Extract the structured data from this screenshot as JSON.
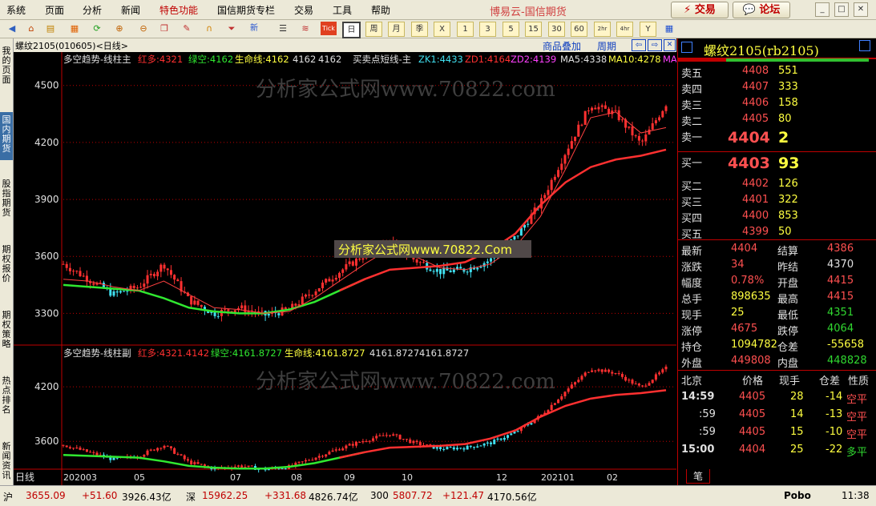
{
  "menu": {
    "items": [
      "系统",
      "页面",
      "分析",
      "新闻",
      "特色功能",
      "国信期货专栏",
      "交易",
      "工具",
      "帮助"
    ],
    "title": "博易云-国信期货",
    "trade_btn": "交易",
    "forum_btn": "论坛"
  },
  "toolbar": {
    "periods": [
      "日",
      "周",
      "月",
      "季",
      "X",
      "1",
      "3",
      "5",
      "15",
      "30",
      "60",
      "2hr",
      "4hr",
      "Y"
    ]
  },
  "sidebar": {
    "items": [
      "我的页面",
      "国内期货",
      "股指期货",
      "期权报价",
      "期权策略",
      "热点排名",
      "新闻资讯"
    ]
  },
  "chart_info": {
    "symbol_code": "螺纹2105(010605)<日线>",
    "overlay_btn": "商品叠加",
    "period_btn": "周期"
  },
  "main_legend": {
    "title": "多空趋势-线柱主",
    "hong": "红多:4321",
    "lv": "绿空:4162",
    "sml": "生命线:4162",
    "v1": "4162",
    "v2": "4162",
    "mm": "买卖点短线-主",
    "zk": "ZK1:4433",
    "zd1": "ZD1:4164",
    "zd2": "ZD2:4139",
    "ma5": "MA5:4338",
    "ma10": "MA10:4278",
    "ma": "MA"
  },
  "sub_legend": {
    "title": "多空趋势-线柱副",
    "hong": "红多:4321.4142",
    "lv": "绿空:4161.8727",
    "sml": "生命线:4161.8727",
    "v1": "4161.8727",
    "v2": "4161.8727"
  },
  "watermark": {
    "text1": "分析家公式网www.70822.com",
    "text2": "分析家公式网www.70822.com",
    "text3": "分析家公式网www.70822.Com"
  },
  "x_axis": {
    "label": "日线",
    "ticks": [
      "202003",
      "05",
      "07",
      "08",
      "09",
      "10",
      "12",
      "202101",
      "02"
    ]
  },
  "colors": {
    "red": "#ff3030",
    "green": "#30e830",
    "cyan": "#40e0f0",
    "chrome": "#ece9d8"
  },
  "chart_data": [
    {
      "type": "line",
      "title": "螺纹2105 日线 (主图)",
      "yticks": [
        3300,
        3600,
        3900,
        4200,
        4500
      ],
      "ylim": [
        3150,
        4600
      ],
      "x": [
        0,
        10,
        20,
        30,
        40,
        50,
        60,
        70,
        80,
        90,
        100,
        110,
        120,
        130,
        140,
        150,
        160,
        170,
        180,
        190,
        200,
        210,
        220,
        230,
        240
      ],
      "close": [
        3560,
        3480,
        3400,
        3440,
        3560,
        3370,
        3300,
        3330,
        3290,
        3320,
        3420,
        3520,
        3610,
        3680,
        3580,
        3520,
        3530,
        3580,
        3700,
        3880,
        4150,
        4400,
        4350,
        4190,
        4404
      ],
      "lifeline": [
        3450,
        3440,
        3430,
        3420,
        3380,
        3330,
        3310,
        3300,
        3300,
        3320,
        3360,
        3420,
        3480,
        3530,
        3540,
        3550,
        3570,
        3630,
        3720,
        3870,
        3990,
        4070,
        4110,
        4130,
        4162
      ],
      "ma10": [
        3480,
        3470,
        3440,
        3420,
        3470,
        3400,
        3330,
        3320,
        3300,
        3310,
        3380,
        3470,
        3560,
        3640,
        3600,
        3540,
        3530,
        3560,
        3650,
        3810,
        4060,
        4330,
        4360,
        4250,
        4278
      ]
    },
    {
      "type": "line",
      "title": "多空趋势-线柱副",
      "yticks": [
        3600,
        4200
      ],
      "ylim": [
        3320,
        4500
      ],
      "x": [
        0,
        10,
        20,
        30,
        40,
        50,
        60,
        70,
        80,
        90,
        100,
        110,
        120,
        130,
        140,
        150,
        160,
        170,
        180,
        190,
        200,
        210,
        220,
        230,
        240
      ],
      "close": [
        3560,
        3480,
        3400,
        3440,
        3560,
        3370,
        3300,
        3330,
        3290,
        3320,
        3420,
        3520,
        3610,
        3680,
        3580,
        3520,
        3530,
        3580,
        3700,
        3880,
        4150,
        4400,
        4350,
        4190,
        4404
      ],
      "lifeline": [
        3450,
        3440,
        3430,
        3420,
        3380,
        3330,
        3310,
        3300,
        3300,
        3320,
        3360,
        3420,
        3480,
        3530,
        3540,
        3550,
        3570,
        3630,
        3720,
        3870,
        3990,
        4070,
        4110,
        4130,
        4162
      ]
    }
  ],
  "quote": {
    "title": "螺纹2105(rb2105)",
    "asks": [
      {
        "label": "卖五",
        "price": "4408",
        "vol": "551"
      },
      {
        "label": "卖四",
        "price": "4407",
        "vol": "333"
      },
      {
        "label": "卖三",
        "price": "4406",
        "vol": "158"
      },
      {
        "label": "卖二",
        "price": "4405",
        "vol": "80"
      }
    ],
    "ask1": {
      "label": "卖一",
      "price": "4404",
      "vol": "2"
    },
    "bid1": {
      "label": "买一",
      "price": "4403",
      "vol": "93"
    },
    "bids": [
      {
        "label": "买二",
        "price": "4402",
        "vol": "126"
      },
      {
        "label": "买三",
        "price": "4401",
        "vol": "322"
      },
      {
        "label": "买四",
        "price": "4400",
        "vol": "853"
      },
      {
        "label": "买五",
        "price": "4399",
        "vol": "50"
      }
    ],
    "stats": [
      {
        "l1": "最新",
        "v1": "4404",
        "c1": "red",
        "l2": "结算",
        "v2": "4386",
        "c2": "red"
      },
      {
        "l1": "涨跌",
        "v1": "34",
        "c1": "red",
        "l2": "昨结",
        "v2": "4370",
        "c2": "white"
      },
      {
        "l1": "幅度",
        "v1": "0.78%",
        "c1": "red",
        "l2": "开盘",
        "v2": "4415",
        "c2": "red"
      },
      {
        "l1": "总手",
        "v1": "898635",
        "c1": "yellow",
        "l2": "最高",
        "v2": "4415",
        "c2": "red"
      },
      {
        "l1": "现手",
        "v1": "25",
        "c1": "yellow",
        "l2": "最低",
        "v2": "4351",
        "c2": "green"
      },
      {
        "l1": "涨停",
        "v1": "4675",
        "c1": "red",
        "l2": "跌停",
        "v2": "4064",
        "c2": "green"
      },
      {
        "l1": "持仓",
        "v1": "1094782",
        "c1": "yellow",
        "l2": "仓差",
        "v2": "-55658",
        "c2": "yellow"
      },
      {
        "l1": "外盘",
        "v1": "449808",
        "c1": "red",
        "l2": "内盘",
        "v2": "448828",
        "c2": "green"
      }
    ],
    "tick_headers": [
      "北京",
      "价格",
      "现手",
      "仓差",
      "性质"
    ],
    "ticks": [
      {
        "time": "14:59",
        "price": "4405",
        "vol": "28",
        "diff": "-14",
        "nature": "空平",
        "nc": "red"
      },
      {
        "time": ":59",
        "price": "4405",
        "vol": "14",
        "diff": "-13",
        "nature": "空平",
        "nc": "red"
      },
      {
        "time": ":59",
        "price": "4405",
        "vol": "15",
        "diff": "-10",
        "nature": "空平",
        "nc": "red"
      },
      {
        "time": "15:00",
        "price": "4404",
        "vol": "25",
        "diff": "-22",
        "nature": "多平",
        "nc": "green"
      }
    ],
    "tab": "笔"
  },
  "status": {
    "sh_label": "沪",
    "sh_idx": "3655.09",
    "sh_chg": "+51.60",
    "sh_amt": "3926.43亿",
    "sz_label": "深",
    "sz_idx": "15962.25",
    "sz_chg": "+331.68",
    "sz_amt": "4826.74亿",
    "hs_label": "300",
    "hs_idx": "5807.72",
    "hs_chg": "+121.47",
    "hs_amt": "4170.56亿",
    "brand": "Pobo",
    "time": "11:38"
  }
}
